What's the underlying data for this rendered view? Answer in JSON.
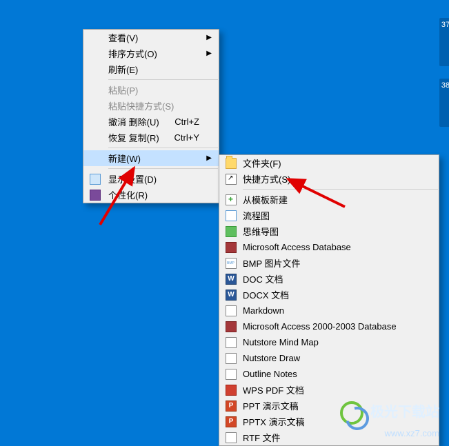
{
  "sidebar_labels": {
    "top": "37",
    "bottom": "38"
  },
  "menu1": {
    "view": "查看(V)",
    "sort": "排序方式(O)",
    "refresh": "刷新(E)",
    "paste": "粘贴(P)",
    "paste_shortcut": "粘贴快捷方式(S)",
    "undo_delete": "撤消 删除(U)",
    "undo_delete_key": "Ctrl+Z",
    "redo_copy": "恢复 复制(R)",
    "redo_copy_key": "Ctrl+Y",
    "new": "新建(W)",
    "display": "显示设置(D)",
    "personalize": "个性化(R)"
  },
  "menu2": {
    "folder": "文件夹(F)",
    "shortcut": "快捷方式(S)",
    "from_template": "从模板新建",
    "flowchart": "流程图",
    "mindmap": "思维导图",
    "access_db": "Microsoft Access Database",
    "bmp": "BMP 图片文件",
    "doc": "DOC 文档",
    "docx": "DOCX 文档",
    "markdown": "Markdown",
    "access2000": "Microsoft Access 2000-2003 Database",
    "nutstore_mind": "Nutstore Mind Map",
    "nutstore_draw": "Nutstore Draw",
    "outline": "Outline Notes",
    "wps_pdf": "WPS PDF 文档",
    "ppt": "PPT 演示文稿",
    "pptx": "PPTX 演示文稿",
    "rtf": "RTF 文件"
  },
  "arrow_glyph": "▶",
  "watermark": {
    "title": "极光下载站",
    "url": "www.xz7.com"
  }
}
